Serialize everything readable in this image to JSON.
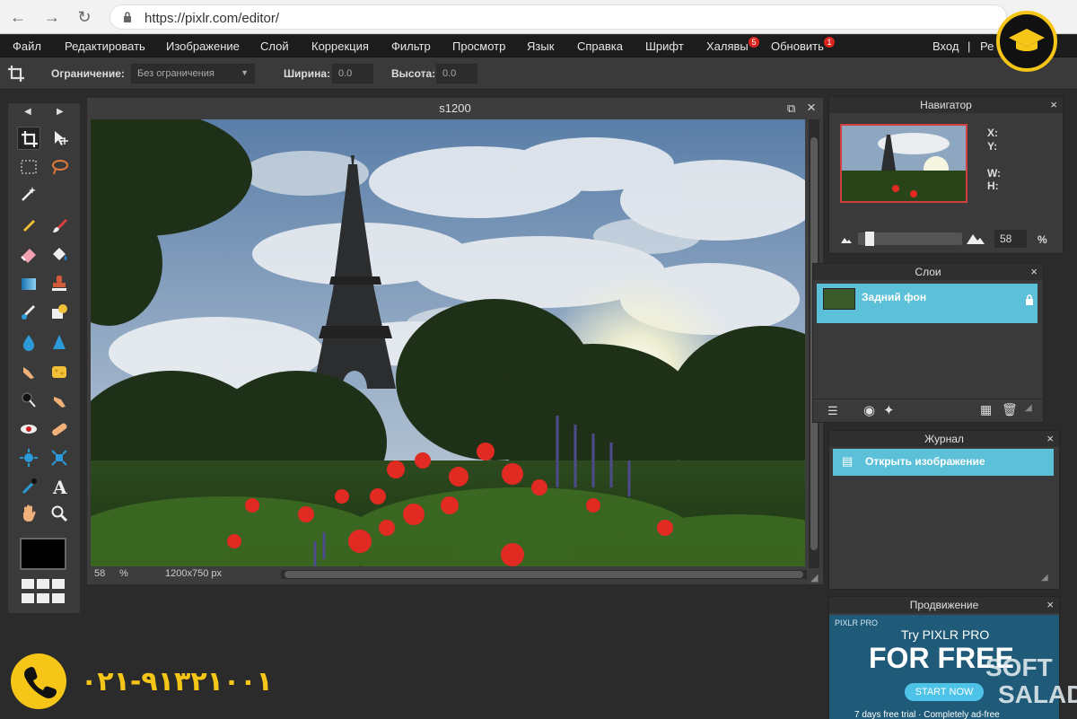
{
  "browser": {
    "url": "https://pixlr.com/editor/"
  },
  "menu": {
    "items": [
      "Файл",
      "Редактировать",
      "Изображение",
      "Слой",
      "Коррекция",
      "Фильтр",
      "Просмотр",
      "Язык",
      "Справка",
      "Шрифт",
      "Халявы",
      "Обновить"
    ],
    "freebies_badge": "5",
    "update_badge": "1",
    "login": "Вход",
    "sep": "|",
    "register": "Ре"
  },
  "options": {
    "constraint_label": "Ограничение:",
    "constraint_value": "Без ограничения",
    "width_label": "Ширина:",
    "width_value": "0.0",
    "height_label": "Высота:",
    "height_value": "0.0"
  },
  "canvas": {
    "title": "s1200",
    "zoom": "58",
    "zoom_unit": "%",
    "size": "1200x750 px"
  },
  "navigator": {
    "title": "Навигатор",
    "x_label": "X:",
    "y_label": "Y:",
    "w_label": "W:",
    "h_label": "H:",
    "zoom": "58",
    "zoom_unit": "%",
    "zoom_fraction": 0.08
  },
  "layers": {
    "title": "Слои",
    "items": [
      {
        "name": "Задний фон"
      }
    ]
  },
  "history": {
    "title": "Журнал",
    "items": [
      {
        "name": "Открыть изображение"
      }
    ]
  },
  "promo": {
    "title": "Продвижение",
    "brand": "PIXLR PRO",
    "headline1": "Try PIXLR PRO",
    "headline2": "FOR FREE",
    "cta": "START NOW",
    "footer": "7 days free trial · Completely ad-free"
  },
  "watermark": {
    "phone": "۰۲۱-۹۱۳۲۱۰۰۱",
    "brand1": "SOFT",
    "brand2": "SALAD"
  },
  "colors": {
    "accent": "#5bc0d8",
    "badge": "#d9251d",
    "watermark": "#f5c518"
  },
  "close_glyph": "×"
}
